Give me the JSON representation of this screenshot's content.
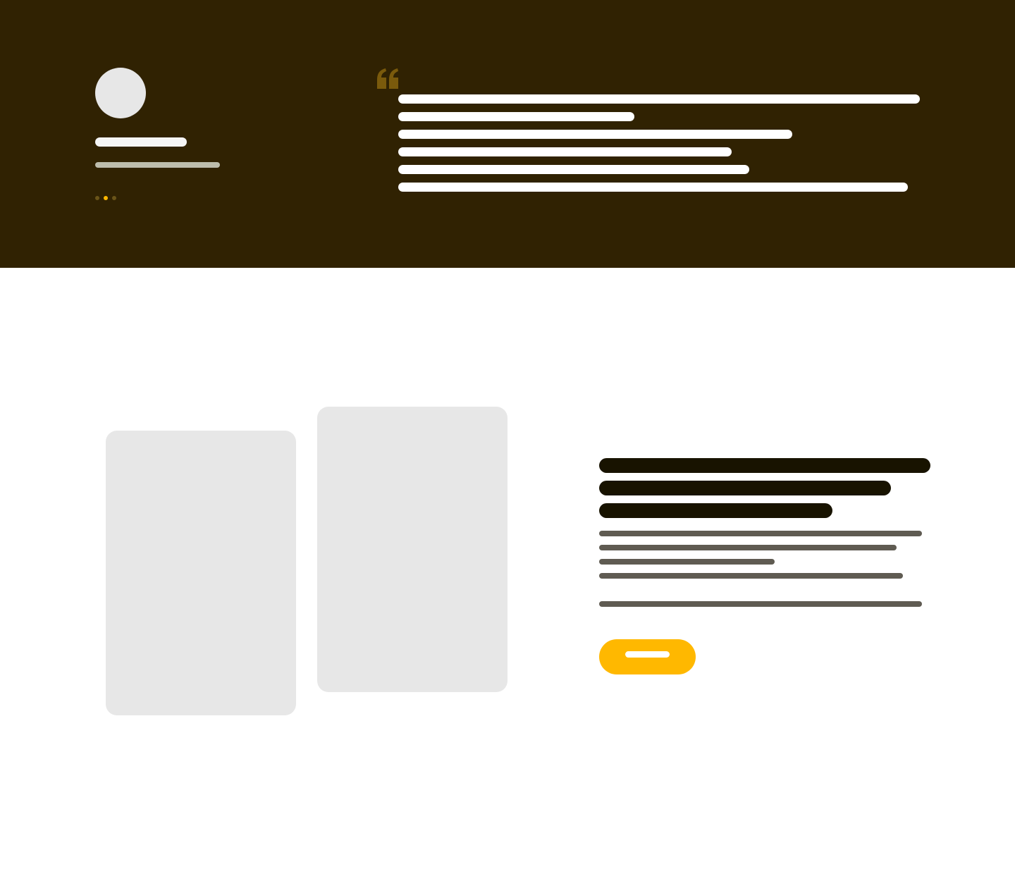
{
  "theme": {
    "band_color": "#302202",
    "accent_color": "#ffb800",
    "heading_color": "#181300",
    "body_text_color": "#5f5b52"
  },
  "testimonial": {
    "icons": {
      "quote": "quote-icon"
    },
    "carousel": {
      "count": 3,
      "active_index": 1
    }
  },
  "feature": {
    "cta": {
      "style": "pill",
      "color": "#ffb800"
    }
  }
}
